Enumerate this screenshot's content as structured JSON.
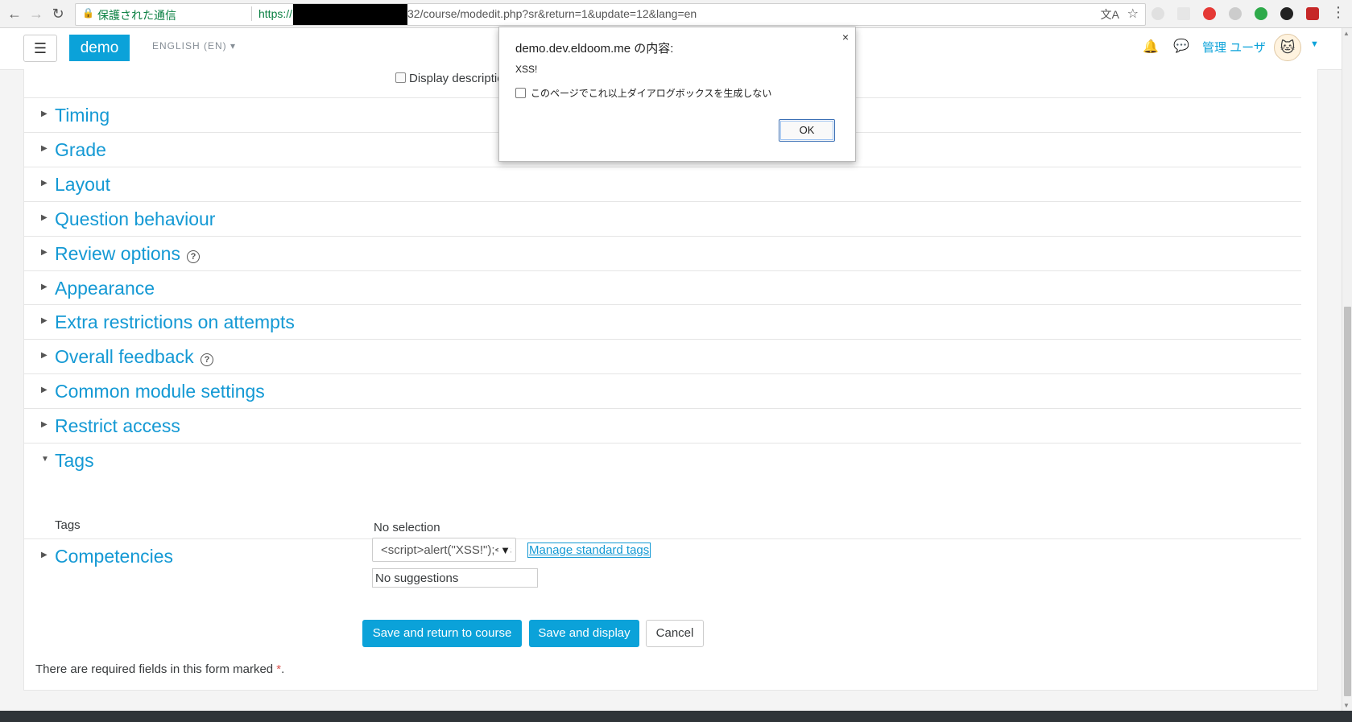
{
  "browser": {
    "secure_label": "保護された通信",
    "url_prefix": "https://",
    "url_path": "32/course/modedit.php?sr&return=1&update=12&lang=en"
  },
  "navbar": {
    "menu_glyph": "☰",
    "brand": "demo",
    "language": "ENGLISH (EN)",
    "user_name": "管理 ユーザ"
  },
  "form": {
    "display_description_label": "Display description or",
    "sections": [
      {
        "title": "Timing",
        "expanded": false,
        "help": false
      },
      {
        "title": "Grade",
        "expanded": false,
        "help": false
      },
      {
        "title": "Layout",
        "expanded": false,
        "help": false
      },
      {
        "title": "Question behaviour",
        "expanded": false,
        "help": false
      },
      {
        "title": "Review options",
        "expanded": false,
        "help": true
      },
      {
        "title": "Appearance",
        "expanded": false,
        "help": false
      },
      {
        "title": "Extra restrictions on attempts",
        "expanded": false,
        "help": false
      },
      {
        "title": "Overall feedback",
        "expanded": false,
        "help": true
      },
      {
        "title": "Common module settings",
        "expanded": false,
        "help": false
      },
      {
        "title": "Restrict access",
        "expanded": false,
        "help": false
      },
      {
        "title": "Tags",
        "expanded": true,
        "help": false
      },
      {
        "title": "Competencies",
        "expanded": false,
        "help": false
      }
    ],
    "tags": {
      "label": "Tags",
      "selection_status": "No selection",
      "input_value": "<script>alert(\"XSS!\");</s",
      "manage_link": "Manage standard tags",
      "suggestions_status": "No suggestions"
    },
    "buttons": {
      "save_return": "Save and return to course",
      "save_display": "Save and display",
      "cancel": "Cancel"
    },
    "required_note": "There are required fields in this form marked",
    "required_marker": "*",
    "required_end": "."
  },
  "dialog": {
    "title": "demo.dev.eldoom.me の内容:",
    "message": "XSS!",
    "suppress_label": "このページでこれ以上ダイアログボックスを生成しない",
    "ok_label": "OK",
    "close_glyph": "×"
  },
  "colors": {
    "brand": "#0ba2d9",
    "link": "#1499d4",
    "required": "#d9534f"
  }
}
